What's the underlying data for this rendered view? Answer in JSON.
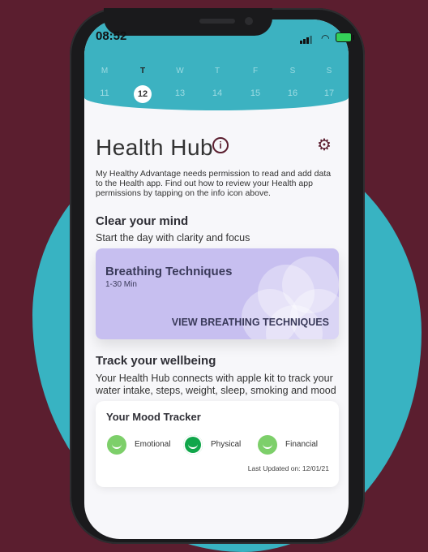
{
  "status_bar": {
    "time": "08:52"
  },
  "week": {
    "days": [
      {
        "letter": "M",
        "date": "11",
        "active": false
      },
      {
        "letter": "T",
        "date": "12",
        "active": true
      },
      {
        "letter": "W",
        "date": "13",
        "active": false
      },
      {
        "letter": "T",
        "date": "14",
        "active": false
      },
      {
        "letter": "F",
        "date": "15",
        "active": false
      },
      {
        "letter": "S",
        "date": "16",
        "active": false
      },
      {
        "letter": "S",
        "date": "17",
        "active": false
      }
    ]
  },
  "header": {
    "title": "Health Hub",
    "info_icon": "i"
  },
  "permission_text": "My Healthy Advantage needs permission to read and add data to the Health app. Find out how to review your Health app permissions by tapping on the info icon above.",
  "clear_mind": {
    "heading": "Clear your mind",
    "subheading": "Start the day with clarity and focus",
    "card": {
      "title": "Breathing Techniques",
      "duration": "1-30 Min",
      "cta": "VIEW BREATHING TECHNIQUES"
    }
  },
  "wellbeing": {
    "heading": "Track your wellbeing",
    "description": "Your Health Hub connects with apple kit to track your water intake, steps, weight, sleep, smoking and mood"
  },
  "mood_tracker": {
    "title": "Your Mood Tracker",
    "items": [
      {
        "label": "Emotional",
        "selected": false
      },
      {
        "label": "Physical",
        "selected": true
      },
      {
        "label": "Financial",
        "selected": false
      }
    ],
    "last_updated": "Last Updated on: 12/01/21"
  },
  "colors": {
    "background": "#5b1e2f",
    "teal": "#38b3c2",
    "card_lavender": "#c7bff0",
    "mood_selected": "#10a64a",
    "mood_default": "#7dcf6a"
  }
}
